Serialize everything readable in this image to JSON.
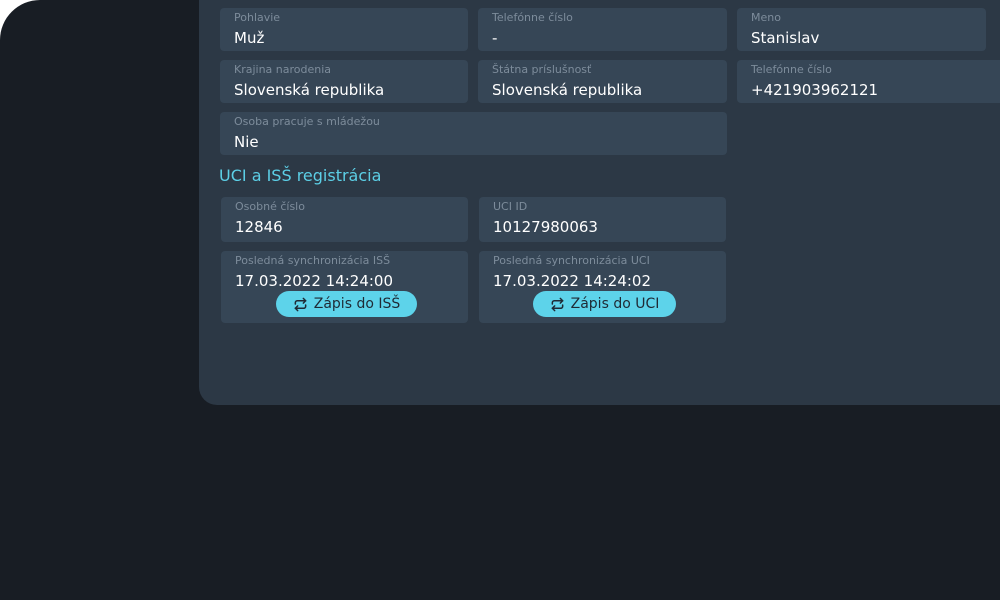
{
  "personal": {
    "gender": {
      "label": "Pohlavie",
      "value": "Muž"
    },
    "phone_left": {
      "label": "Telefónne číslo",
      "value": "-"
    },
    "first_name": {
      "label": "Meno",
      "value": "Stanislav"
    },
    "birth_country": {
      "label": "Krajina narodenia",
      "value": "Slovenská republika"
    },
    "citizenship": {
      "label": "Štátna príslušnosť",
      "value": "Slovenská republika"
    },
    "phone_right": {
      "label": "Telefónne číslo",
      "value": "+421903962121"
    },
    "works_with_youth": {
      "label": "Osoba pracuje s mládežou",
      "value": "Nie"
    }
  },
  "registration": {
    "title": "UCI a ISŠ registrácia",
    "personal_number": {
      "label": "Osobné číslo",
      "value": "12846"
    },
    "uci_id": {
      "label": "UCI ID",
      "value": "10127980063"
    },
    "last_sync_iss": {
      "label": "Posledná synchronizácia ISŠ",
      "value": "17.03.2022 14:24:00"
    },
    "last_sync_uci": {
      "label": "Posledná synchronizácia UCI",
      "value": "17.03.2022 14:24:02"
    },
    "btn_iss": "Zápis do ISŠ",
    "btn_uci": "Zápis do UCI"
  },
  "colors": {
    "accent": "#5dd3ea",
    "panel": "#2c3845",
    "field": "#364656",
    "background": "#181d24"
  }
}
